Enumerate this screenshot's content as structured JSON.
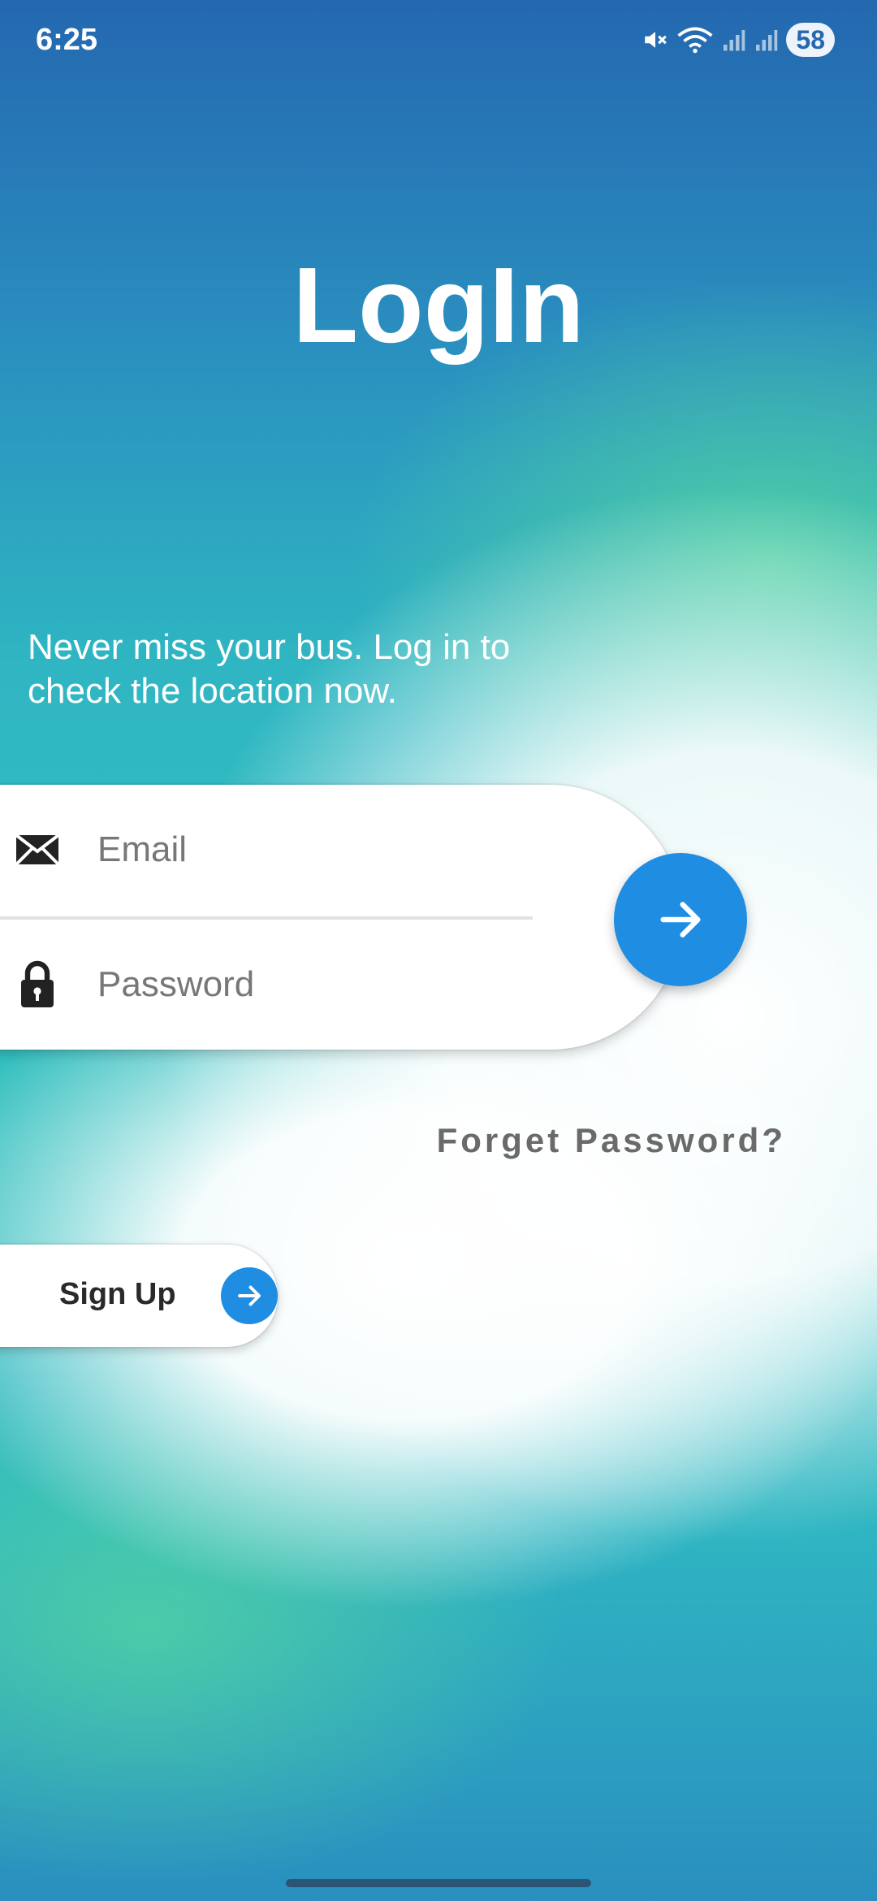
{
  "status_bar": {
    "time": "6:25",
    "battery": "58",
    "icons": [
      "mute-icon",
      "wifi-icon",
      "signal-icon",
      "signal-icon"
    ]
  },
  "screen": {
    "title": "LogIn",
    "subtitle": "Never miss your bus. Log in to check the location now."
  },
  "form": {
    "email_placeholder": "Email",
    "email_icon": "mail-icon",
    "password_placeholder": "Password",
    "password_icon": "lock-icon",
    "submit_icon": "arrow-right-icon"
  },
  "links": {
    "forgot_password": "Forget Password?",
    "sign_up": "Sign Up"
  },
  "colors": {
    "accent": "#1e8de2",
    "title_text": "#ffffff",
    "muted_text": "#6a6a6a"
  }
}
